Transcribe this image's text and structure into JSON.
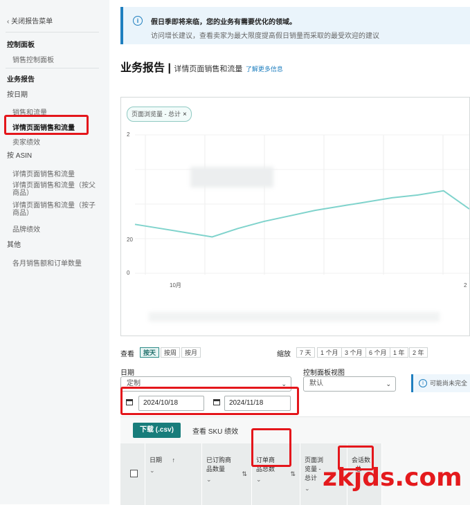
{
  "sidebar": {
    "close_menu": "关闭报告菜单",
    "section_dashboard": "控制面板",
    "sales_dashboard": "销售控制面板",
    "section_reports": "业务报告",
    "by_date": "按日期",
    "sales_traffic": "销售和流量",
    "detail_page_sales_traffic": "详情页面销售和流量",
    "seller_performance": "卖家绩效",
    "by_asin": "按 ASIN",
    "asin_detail_sales_traffic": "详情页面销售和流量",
    "asin_detail_parent_line1": "详情页面销售和流量（按父",
    "asin_detail_parent_line2": "商品）",
    "asin_detail_child_line1": "详情页面销售和流量（按子",
    "asin_detail_child_line2": "商品）",
    "brand_performance": "品牌绩效",
    "section_other": "其他",
    "monthly_sales_orders": "各月销售额和订单数量"
  },
  "banner": {
    "title": "假日季即将来临，您的业务有需要优化的领域。",
    "description": "访问增长建议，查看卖家为最大限度提高假日销量而采取的最受欢迎的建议"
  },
  "page": {
    "title": "业务报告",
    "separator": "|",
    "subtitle": "详情页面销售和流量",
    "learn_more": "了解更多信息"
  },
  "chart": {
    "chip_label": "页面浏览量 - 总计",
    "chip_close": "×"
  },
  "chart_data": {
    "type": "line",
    "title": "",
    "xlabel": "",
    "ylabel": "",
    "x_tick_labels": [
      "10月",
      "2"
    ],
    "y_tick_labels": [
      "2",
      "20",
      "0"
    ],
    "ylim": [
      0,
      100
    ],
    "grid": true,
    "series": [
      {
        "color": "#7fd3cc",
        "x": [
          0,
          1,
          2,
          3,
          4,
          5,
          6,
          7,
          8,
          9,
          10,
          11,
          12,
          13
        ],
        "values": [
          36,
          33,
          30,
          27,
          33,
          38,
          42,
          46,
          49,
          52,
          55,
          57,
          60,
          47
        ]
      }
    ]
  },
  "view": {
    "label": "查看",
    "options": [
      "按天",
      "按周",
      "按月"
    ],
    "active": "按天"
  },
  "granularity": {
    "label": "缩放",
    "options": [
      "7 天",
      "1 个月",
      "3 个月",
      "6 个月",
      "1 年",
      "2 年"
    ]
  },
  "date": {
    "label": "日期",
    "select_value": "定制",
    "start": "2024/10/18",
    "end": "2024/11/18"
  },
  "dashboard_view": {
    "label": "控制面板视图",
    "select_value": "默认"
  },
  "notice": {
    "text": "可能尚未完全"
  },
  "table": {
    "download_label": "下载 (.csv)",
    "sku_link": "查看 SKU 绩效",
    "columns": [
      {
        "line1": "日期",
        "line2": ""
      },
      {
        "line1": "已订购商",
        "line2": "品数量"
      },
      {
        "line1": "订单商",
        "line2": "品总数"
      },
      {
        "line1": "页面浏",
        "line2": "览量 -",
        "line3": "总计"
      },
      {
        "line1": "会话数",
        "line2": "- 总"
      }
    ]
  },
  "watermark": "zkjds.com",
  "colors": {
    "accent": "#187d7b",
    "highlight": "#e4161b",
    "line": "#7fd3cc",
    "info": "#1f7fbf"
  }
}
